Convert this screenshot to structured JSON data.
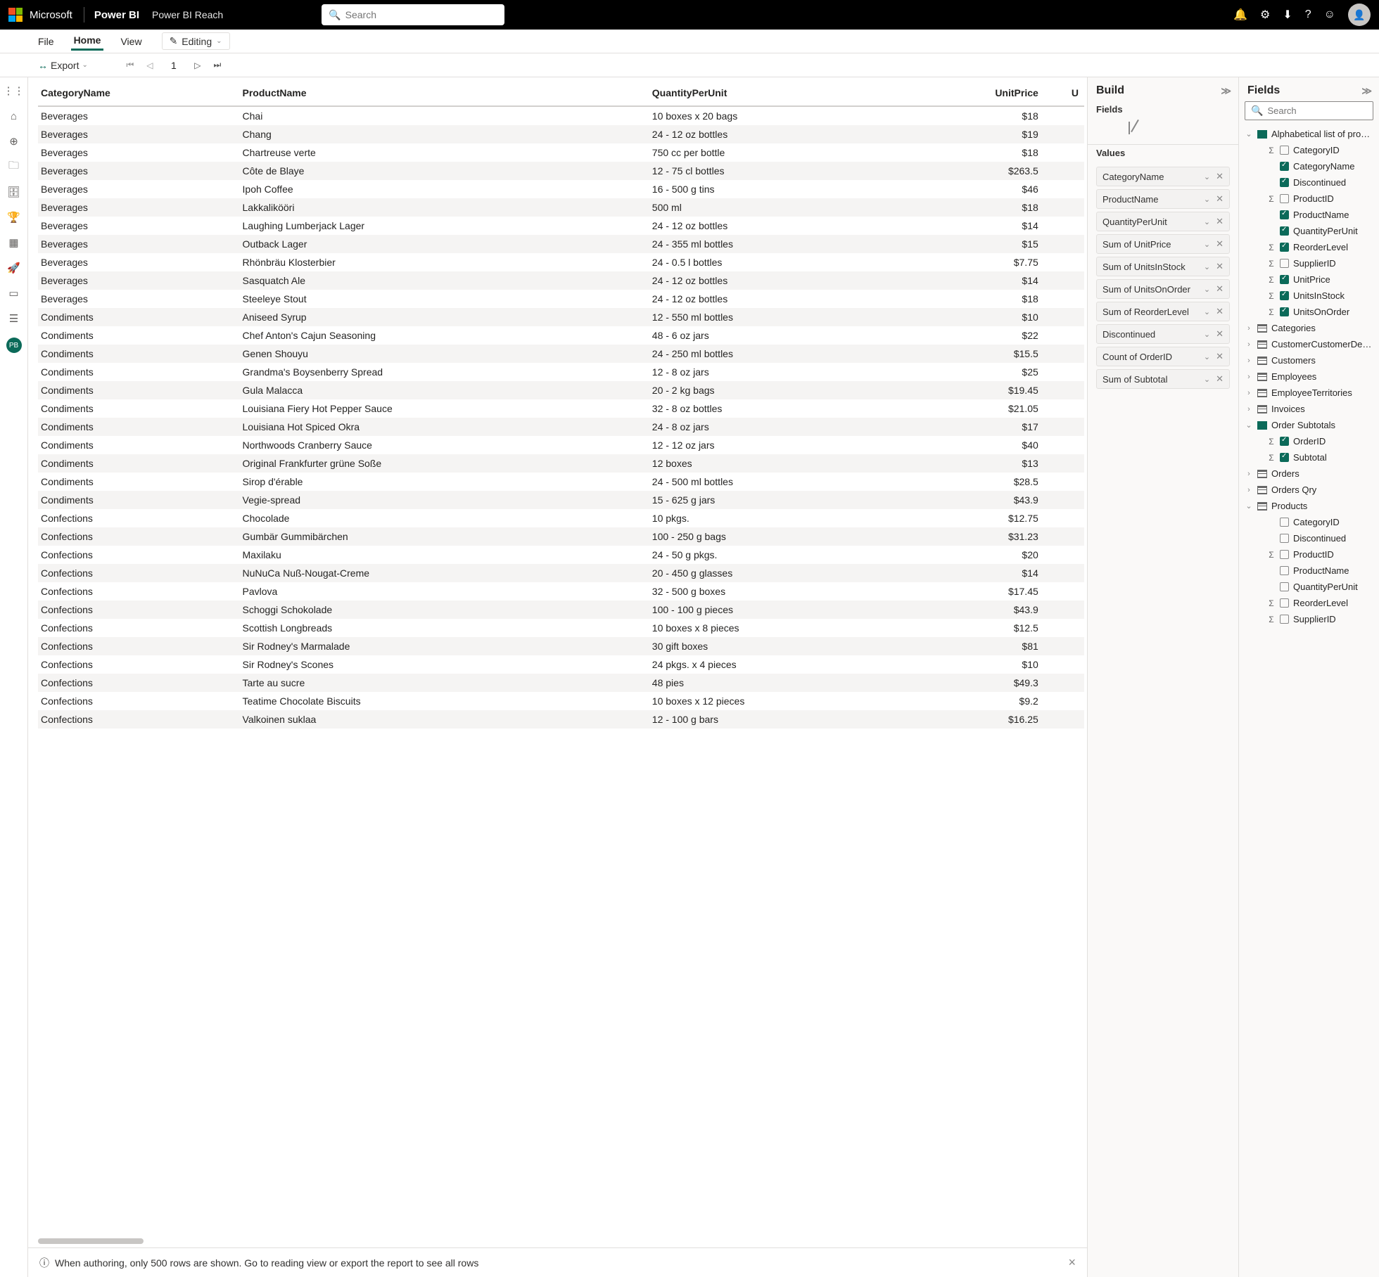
{
  "topbar": {
    "ms": "Microsoft",
    "brand": "Power BI",
    "docTitle": "Power BI Reach",
    "searchPlaceholder": "Search"
  },
  "ribbon": {
    "tabs": [
      "File",
      "Home",
      "View"
    ],
    "activeTab": "Home",
    "editing": "Editing"
  },
  "toolbar": {
    "export": "Export",
    "page": "1"
  },
  "leftnavBadge": "PB",
  "table": {
    "columns": [
      "CategoryName",
      "ProductName",
      "QuantityPerUnit",
      "UnitPrice",
      "U"
    ],
    "rows": [
      [
        "Beverages",
        "Chai",
        "10 boxes x 20 bags",
        "$18"
      ],
      [
        "Beverages",
        "Chang",
        "24 - 12 oz bottles",
        "$19"
      ],
      [
        "Beverages",
        "Chartreuse verte",
        "750 cc per bottle",
        "$18"
      ],
      [
        "Beverages",
        "Côte de Blaye",
        "12 - 75 cl bottles",
        "$263.5"
      ],
      [
        "Beverages",
        "Ipoh Coffee",
        "16 - 500 g tins",
        "$46"
      ],
      [
        "Beverages",
        "Lakkalikööri",
        "500 ml",
        "$18"
      ],
      [
        "Beverages",
        "Laughing Lumberjack Lager",
        "24 - 12 oz bottles",
        "$14"
      ],
      [
        "Beverages",
        "Outback Lager",
        "24 - 355 ml bottles",
        "$15"
      ],
      [
        "Beverages",
        "Rhönbräu Klosterbier",
        "24 - 0.5 l bottles",
        "$7.75"
      ],
      [
        "Beverages",
        "Sasquatch Ale",
        "24 - 12 oz bottles",
        "$14"
      ],
      [
        "Beverages",
        "Steeleye Stout",
        "24 - 12 oz bottles",
        "$18"
      ],
      [
        "Condiments",
        "Aniseed Syrup",
        "12 - 550 ml bottles",
        "$10"
      ],
      [
        "Condiments",
        "Chef Anton's Cajun Seasoning",
        "48 - 6 oz jars",
        "$22"
      ],
      [
        "Condiments",
        "Genen Shouyu",
        "24 - 250 ml bottles",
        "$15.5"
      ],
      [
        "Condiments",
        "Grandma's Boysenberry Spread",
        "12 - 8 oz jars",
        "$25"
      ],
      [
        "Condiments",
        "Gula Malacca",
        "20 - 2 kg bags",
        "$19.45"
      ],
      [
        "Condiments",
        "Louisiana Fiery Hot Pepper Sauce",
        "32 - 8 oz bottles",
        "$21.05"
      ],
      [
        "Condiments",
        "Louisiana Hot Spiced Okra",
        "24 - 8 oz jars",
        "$17"
      ],
      [
        "Condiments",
        "Northwoods Cranberry Sauce",
        "12 - 12 oz jars",
        "$40"
      ],
      [
        "Condiments",
        "Original Frankfurter grüne Soße",
        "12 boxes",
        "$13"
      ],
      [
        "Condiments",
        "Sirop d'érable",
        "24 - 500 ml bottles",
        "$28.5"
      ],
      [
        "Condiments",
        "Vegie-spread",
        "15 - 625 g jars",
        "$43.9"
      ],
      [
        "Confections",
        "Chocolade",
        "10 pkgs.",
        "$12.75"
      ],
      [
        "Confections",
        "Gumbär Gummibärchen",
        "100 - 250 g bags",
        "$31.23"
      ],
      [
        "Confections",
        "Maxilaku",
        "24 - 50 g pkgs.",
        "$20"
      ],
      [
        "Confections",
        "NuNuCa Nuß-Nougat-Creme",
        "20 - 450 g glasses",
        "$14"
      ],
      [
        "Confections",
        "Pavlova",
        "32 - 500 g boxes",
        "$17.45"
      ],
      [
        "Confections",
        "Schoggi Schokolade",
        "100 - 100 g pieces",
        "$43.9"
      ],
      [
        "Confections",
        "Scottish Longbreads",
        "10 boxes x 8 pieces",
        "$12.5"
      ],
      [
        "Confections",
        "Sir Rodney's Marmalade",
        "30 gift boxes",
        "$81"
      ],
      [
        "Confections",
        "Sir Rodney's Scones",
        "24 pkgs. x 4 pieces",
        "$10"
      ],
      [
        "Confections",
        "Tarte au sucre",
        "48 pies",
        "$49.3"
      ],
      [
        "Confections",
        "Teatime Chocolate Biscuits",
        "10 boxes x 12 pieces",
        "$9.2"
      ],
      [
        "Confections",
        "Valkoinen suklaa",
        "12 - 100 g bars",
        "$16.25"
      ]
    ]
  },
  "footerNote": "When authoring, only 500 rows are shown. Go to reading view or export the report to see all rows",
  "buildPane": {
    "title": "Build",
    "fieldsLabel": "Fields",
    "valuesLabel": "Values",
    "valueFields": [
      "CategoryName",
      "ProductName",
      "QuantityPerUnit",
      "Sum of UnitPrice",
      "Sum of UnitsInStock",
      "Sum of UnitsOnOrder",
      "Sum of ReorderLevel",
      "Discontinued",
      "Count of OrderID",
      "Sum of Subtotal"
    ]
  },
  "fieldsPane": {
    "title": "Fields",
    "searchPlaceholder": "Search",
    "tables": [
      {
        "name": "Alphabetical list of pro…",
        "expanded": true,
        "selected": true,
        "fields": [
          {
            "name": "CategoryID",
            "sigma": true,
            "checked": false
          },
          {
            "name": "CategoryName",
            "checked": true
          },
          {
            "name": "Discontinued",
            "checked": true
          },
          {
            "name": "ProductID",
            "sigma": true,
            "checked": false
          },
          {
            "name": "ProductName",
            "checked": true
          },
          {
            "name": "QuantityPerUnit",
            "checked": true
          },
          {
            "name": "ReorderLevel",
            "sigma": true,
            "checked": true
          },
          {
            "name": "SupplierID",
            "sigma": true,
            "checked": false
          },
          {
            "name": "UnitPrice",
            "sigma": true,
            "checked": true
          },
          {
            "name": "UnitsInStock",
            "sigma": true,
            "checked": true
          },
          {
            "name": "UnitsOnOrder",
            "sigma": true,
            "checked": true
          }
        ]
      },
      {
        "name": "Categories"
      },
      {
        "name": "CustomerCustomerDe…"
      },
      {
        "name": "Customers"
      },
      {
        "name": "Employees"
      },
      {
        "name": "EmployeeTerritories"
      },
      {
        "name": "Invoices"
      },
      {
        "name": "Order Subtotals",
        "expanded": true,
        "selected": true,
        "fields": [
          {
            "name": "OrderID",
            "sigma": true,
            "checked": true
          },
          {
            "name": "Subtotal",
            "sigma": true,
            "checked": true
          }
        ]
      },
      {
        "name": "Orders"
      },
      {
        "name": "Orders Qry"
      },
      {
        "name": "Products",
        "expanded": true,
        "fields": [
          {
            "name": "CategoryID",
            "checked": false
          },
          {
            "name": "Discontinued",
            "checked": false
          },
          {
            "name": "ProductID",
            "sigma": true,
            "checked": false
          },
          {
            "name": "ProductName",
            "checked": false
          },
          {
            "name": "QuantityPerUnit",
            "checked": false
          },
          {
            "name": "ReorderLevel",
            "sigma": true,
            "checked": false
          },
          {
            "name": "SupplierID",
            "sigma": true,
            "checked": false
          }
        ]
      }
    ]
  }
}
